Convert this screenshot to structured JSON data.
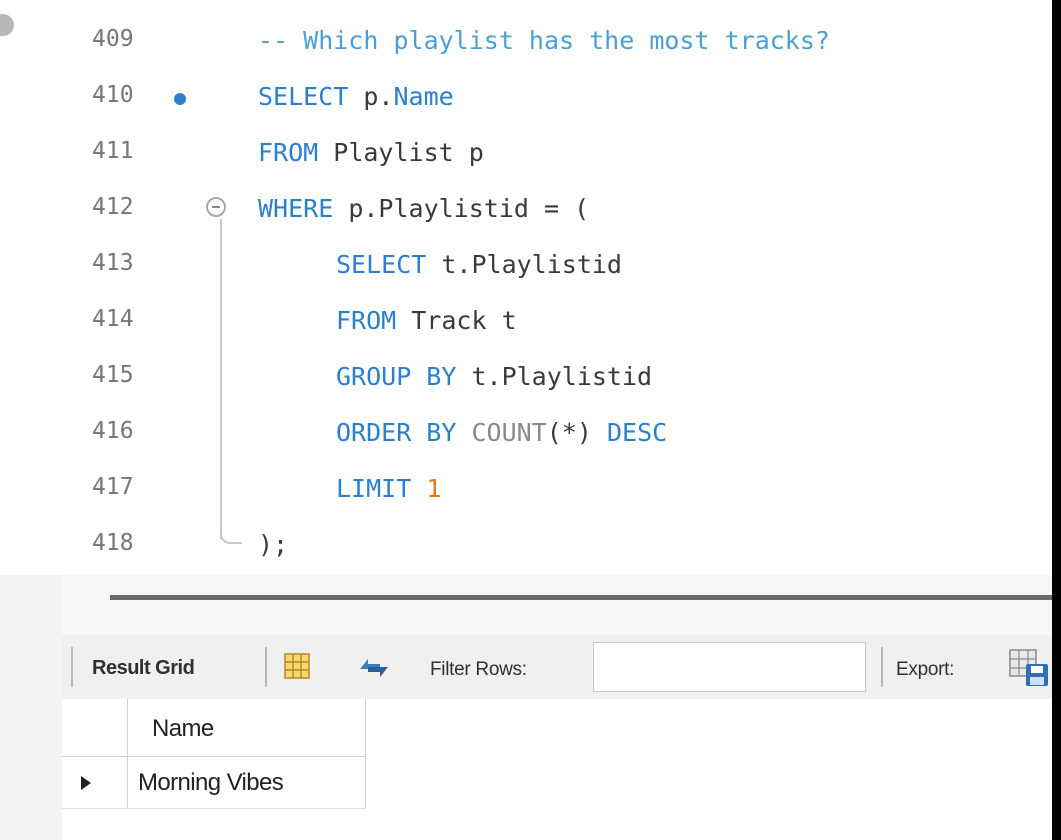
{
  "editor": {
    "lines": [
      {
        "num": "409",
        "indent": 0,
        "tokens": [
          {
            "t": "-- Which playlist has the most tracks?",
            "c": "cm"
          }
        ]
      },
      {
        "num": "410",
        "indent": 0,
        "breakpoint": true,
        "tokens": [
          {
            "t": "SELECT",
            "c": "k"
          },
          {
            "t": " p.",
            "c": "p"
          },
          {
            "t": "Name",
            "c": "k"
          }
        ]
      },
      {
        "num": "411",
        "indent": 0,
        "tokens": [
          {
            "t": "FROM",
            "c": "k"
          },
          {
            "t": " Playlist p",
            "c": "p"
          }
        ]
      },
      {
        "num": "412",
        "indent": 0,
        "fold": true,
        "tokens": [
          {
            "t": "WHERE",
            "c": "k"
          },
          {
            "t": " p.Playlistid = (",
            "c": "p"
          }
        ]
      },
      {
        "num": "413",
        "indent": 1,
        "tokens": [
          {
            "t": "SELECT",
            "c": "k"
          },
          {
            "t": " t.Playlistid",
            "c": "p"
          }
        ]
      },
      {
        "num": "414",
        "indent": 1,
        "tokens": [
          {
            "t": "FROM",
            "c": "k"
          },
          {
            "t": " Track t",
            "c": "p"
          }
        ]
      },
      {
        "num": "415",
        "indent": 1,
        "tokens": [
          {
            "t": "GROUP BY",
            "c": "k"
          },
          {
            "t": " t.Playlistid",
            "c": "p"
          }
        ]
      },
      {
        "num": "416",
        "indent": 1,
        "tokens": [
          {
            "t": "ORDER BY",
            "c": "k"
          },
          {
            "t": " ",
            "c": "p"
          },
          {
            "t": "COUNT",
            "c": "fn"
          },
          {
            "t": "(*) ",
            "c": "p"
          },
          {
            "t": "DESC",
            "c": "k"
          }
        ]
      },
      {
        "num": "417",
        "indent": 1,
        "tokens": [
          {
            "t": "LIMIT",
            "c": "k"
          },
          {
            "t": " ",
            "c": "p"
          },
          {
            "t": "1",
            "c": "num"
          }
        ]
      },
      {
        "num": "418",
        "indent": 0,
        "tokens": [
          {
            "t": ");",
            "c": "p"
          }
        ]
      }
    ]
  },
  "toolbar": {
    "result_grid_label": "Result Grid",
    "filter_label": "Filter Rows:",
    "filter_value": "",
    "export_label": "Export:",
    "icons": [
      "grid-icon",
      "refresh-icon",
      "export-icon"
    ]
  },
  "result_grid": {
    "columns": [
      "Name"
    ],
    "rows": [
      [
        "Morning Vibes"
      ]
    ]
  },
  "colors": {
    "keyword": "#2a7fcf",
    "comment": "#4aa0d6",
    "function": "#8a8a8a",
    "number": "#e07b16",
    "plain": "#3a3a3a",
    "line_number": "#767676",
    "breakpoint": "#2f7fcf"
  }
}
